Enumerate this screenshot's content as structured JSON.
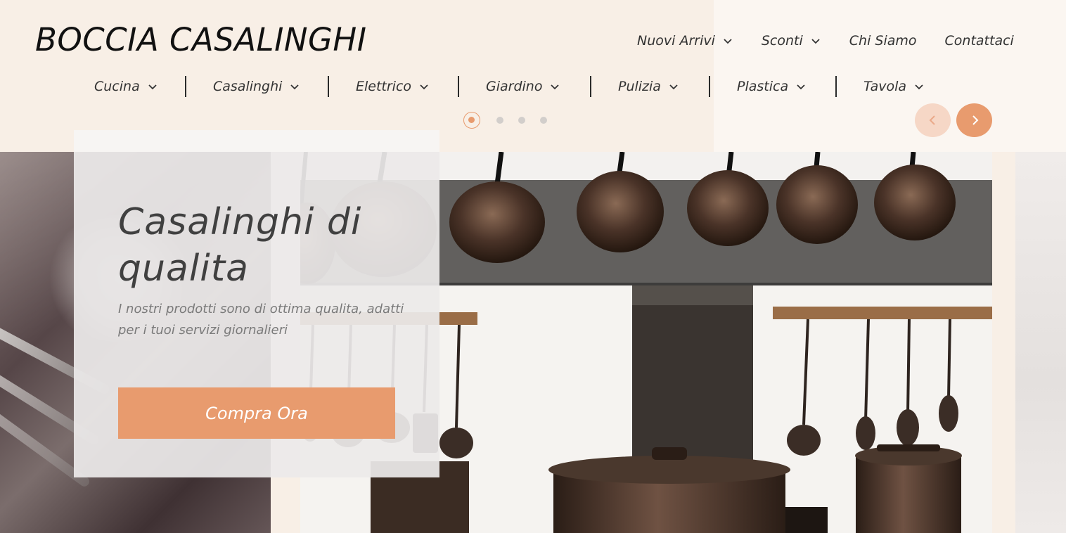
{
  "brand": {
    "name": "BOCCIA CASALINGHI"
  },
  "top_nav": [
    {
      "label": "Nuovi Arrivi",
      "has_dropdown": true
    },
    {
      "label": "Sconti",
      "has_dropdown": true
    },
    {
      "label": "Chi Siamo",
      "has_dropdown": false
    },
    {
      "label": "Contattaci",
      "has_dropdown": false
    }
  ],
  "categories": [
    {
      "label": "Cucina"
    },
    {
      "label": "Casalinghi"
    },
    {
      "label": "Elettrico"
    },
    {
      "label": "Giardino"
    },
    {
      "label": "Pulizia"
    },
    {
      "label": "Plastica"
    },
    {
      "label": "Tavola"
    }
  ],
  "carousel": {
    "slide_count": 4,
    "active_slide": 1,
    "prev_icon": "chevron-left-icon",
    "next_icon": "chevron-right-icon"
  },
  "hero": {
    "title": "Casalinghi di qualita",
    "subtitle": "I nostri prodotti sono di ottima qualita, adatti per i tuoi servizi giornalieri",
    "cta_label": "Compra Ora"
  },
  "colors": {
    "accent": "#e89b6e",
    "accent_light": "#f6d7c6",
    "header_bg": "#f8efe6",
    "text": "#2b2b2b"
  }
}
